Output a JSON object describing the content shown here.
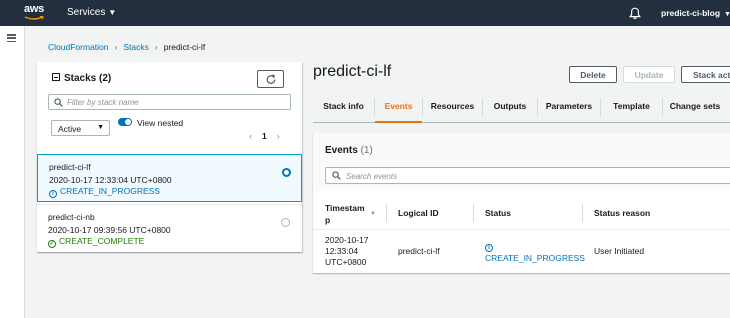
{
  "topbar": {
    "logo": "aws",
    "services_label": "Services",
    "bell_icon": "bell-icon",
    "account_label": "predict-ci-blog"
  },
  "breadcrumb": {
    "items": [
      "CloudFormation",
      "Stacks",
      "predict-ci-lf"
    ]
  },
  "stacks_panel": {
    "title": "Stacks",
    "count": "(2)",
    "search_placeholder": "Filter by stack name",
    "status_filter": "Active",
    "view_nested_label": "View nested",
    "view_nested_on": true,
    "page": "1",
    "stacks": [
      {
        "name": "predict-ci-lf",
        "date": "2020-10-17 12:33:04 UTC+0800",
        "status": "CREATE_IN_PROGRESS",
        "selected": true
      },
      {
        "name": "predict-ci-nb",
        "date": "2020-10-17 09:39:56 UTC+0800",
        "status": "CREATE_COMPLETE",
        "selected": false
      }
    ]
  },
  "detail": {
    "title": "predict-ci-lf",
    "buttons": {
      "delete": "Delete",
      "update": "Update",
      "stack_actions": "Stack actions"
    },
    "tabs": [
      "Stack info",
      "Events",
      "Resources",
      "Outputs",
      "Parameters",
      "Template",
      "Change sets"
    ],
    "active_tab": "Events",
    "events": {
      "title": "Events",
      "count": "(1)",
      "search_placeholder": "Search events",
      "columns": [
        "Timestamp",
        "Logical ID",
        "Status",
        "Status reason"
      ],
      "timestamp_header_lines": [
        "Timestam",
        "p"
      ],
      "rows": [
        {
          "timestamp_lines": [
            "2020-10-17",
            "12:33:04",
            "UTC+0800"
          ],
          "logical_id": "predict-ci-lf",
          "status": "CREATE_IN_PROGRESS",
          "status_reason": "User Initiated"
        }
      ]
    }
  },
  "colors": {
    "topbar": "#232f3e",
    "link": "#0073bb",
    "active_tab": "#ec7211",
    "success": "#1d8102"
  }
}
